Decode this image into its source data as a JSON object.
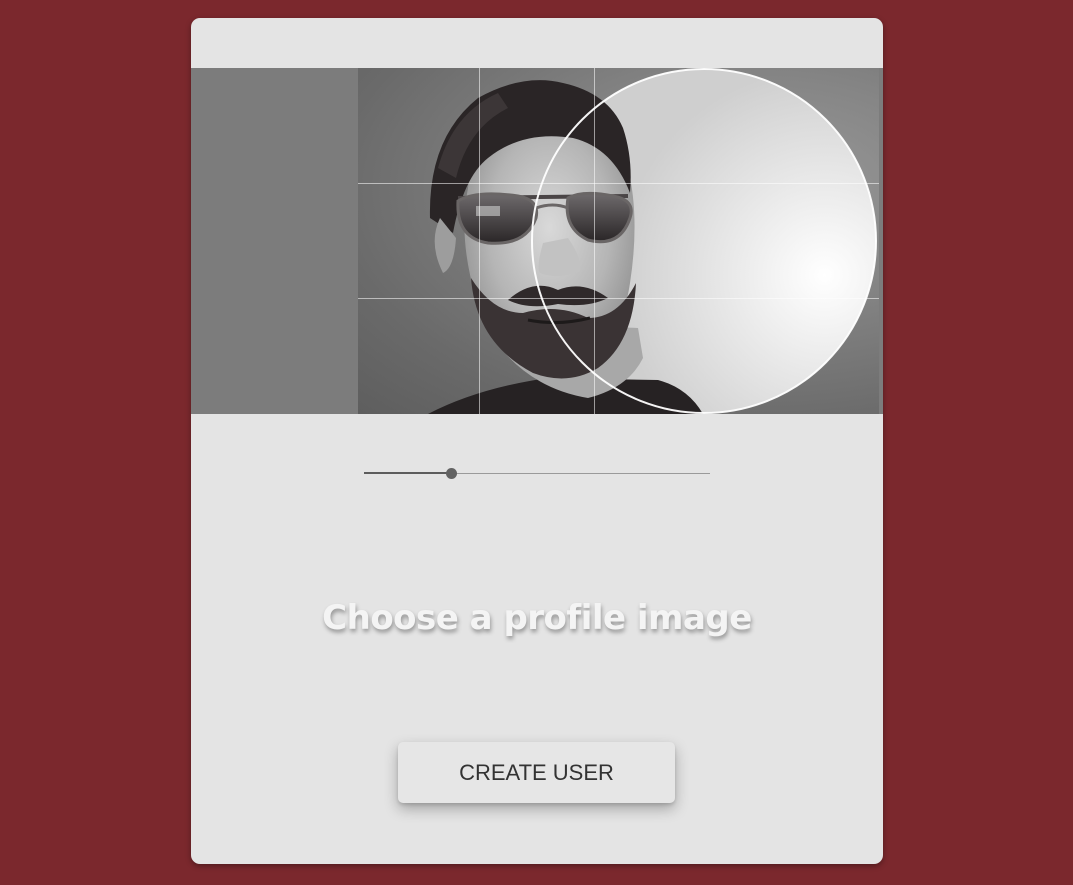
{
  "colors": {
    "background": "#7b282d",
    "card": "#e4e4e4",
    "button_text": "#333333",
    "title_text": "#f4f4f4"
  },
  "cropper": {
    "image_alt": "Profile photo of a bearded man wearing aviator sunglasses",
    "zoom_fraction": 0.25
  },
  "title": "Choose a profile image",
  "create_button": {
    "label": "CREATE USER"
  }
}
